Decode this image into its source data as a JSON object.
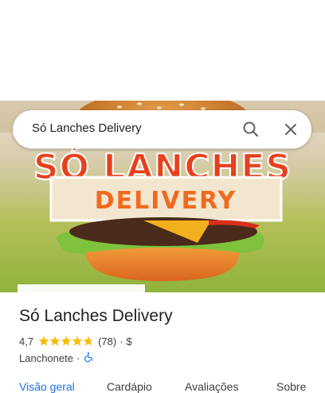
{
  "search": {
    "query": "Só Lanches Delivery",
    "search_icon": "search-icon",
    "close_icon": "close-icon"
  },
  "hero": {
    "logo_line1": "SÓ LANCHES",
    "logo_line2": "DELIVERY"
  },
  "place": {
    "name": "Só Lanches Delivery",
    "rating": "4,7",
    "stars": 4.7,
    "review_count": "(78)",
    "price_separator": "·",
    "price_level": "$",
    "category": "Lanchonete",
    "category_separator": "·",
    "accessibility_icon": "wheelchair-icon"
  },
  "tabs": [
    {
      "label": "Visão geral"
    },
    {
      "label": "Cardápio"
    },
    {
      "label": "Avaliações"
    },
    {
      "label": "Sobre"
    }
  ],
  "colors": {
    "accent": "#1a73e8",
    "star": "#fbbc04",
    "logo_red": "#e8401c",
    "logo_orange": "#f06a1f"
  }
}
